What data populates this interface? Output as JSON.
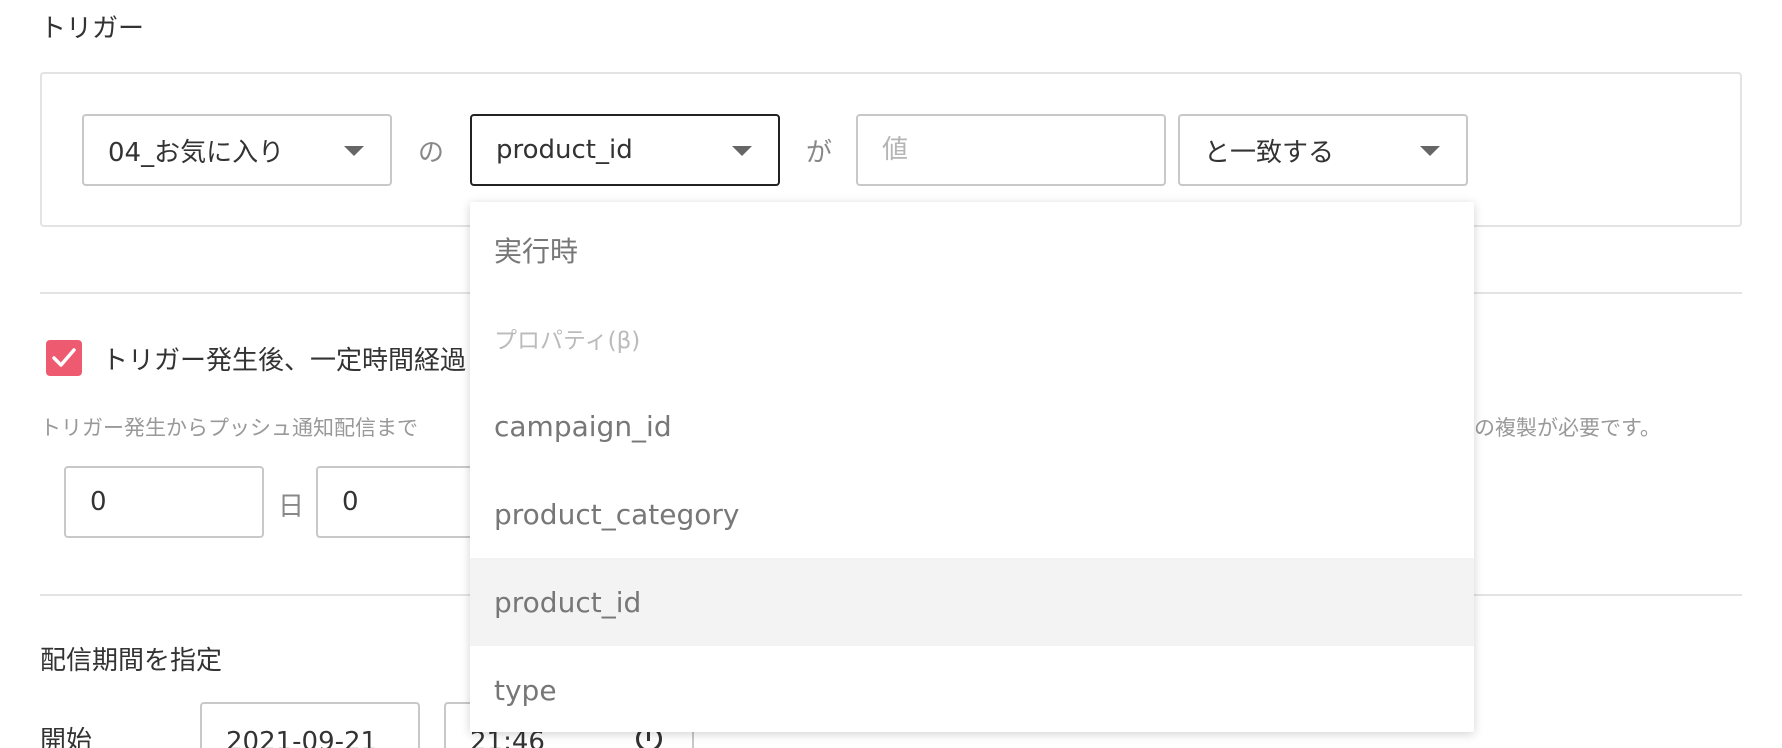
{
  "trigger": {
    "title": "トリガー",
    "event_select_value": "04_お気に入り",
    "connector_no": "の",
    "property_select_value": "product_id",
    "connector_ga": "が",
    "value_placeholder": "値",
    "operator_select_value": "と一致する"
  },
  "delay": {
    "checkbox_label": "トリガー発生後、一定時間経過",
    "help_text_left": "トリガー発生からプッシュ通知配信まで",
    "help_text_right": "の複製が必要です。",
    "days_value": "0",
    "days_unit": "日",
    "hours_value": "0"
  },
  "schedule": {
    "title": "配信期間を指定",
    "start_label": "開始",
    "start_date": "2021-09-21",
    "start_time": "21:46"
  },
  "dropdown": {
    "options": [
      {
        "label": "実行時",
        "kind": "option"
      },
      {
        "label": "プロパティ(β)",
        "kind": "group"
      },
      {
        "label": "campaign_id",
        "kind": "option"
      },
      {
        "label": "product_category",
        "kind": "option"
      },
      {
        "label": "product_id",
        "kind": "option",
        "selected": true
      },
      {
        "label": "type",
        "kind": "option"
      }
    ]
  },
  "colors": {
    "accent": "#ee5a6f",
    "border": "#c8c8c8",
    "focus_border": "#222222",
    "hover_bg": "#f3f3f3"
  }
}
